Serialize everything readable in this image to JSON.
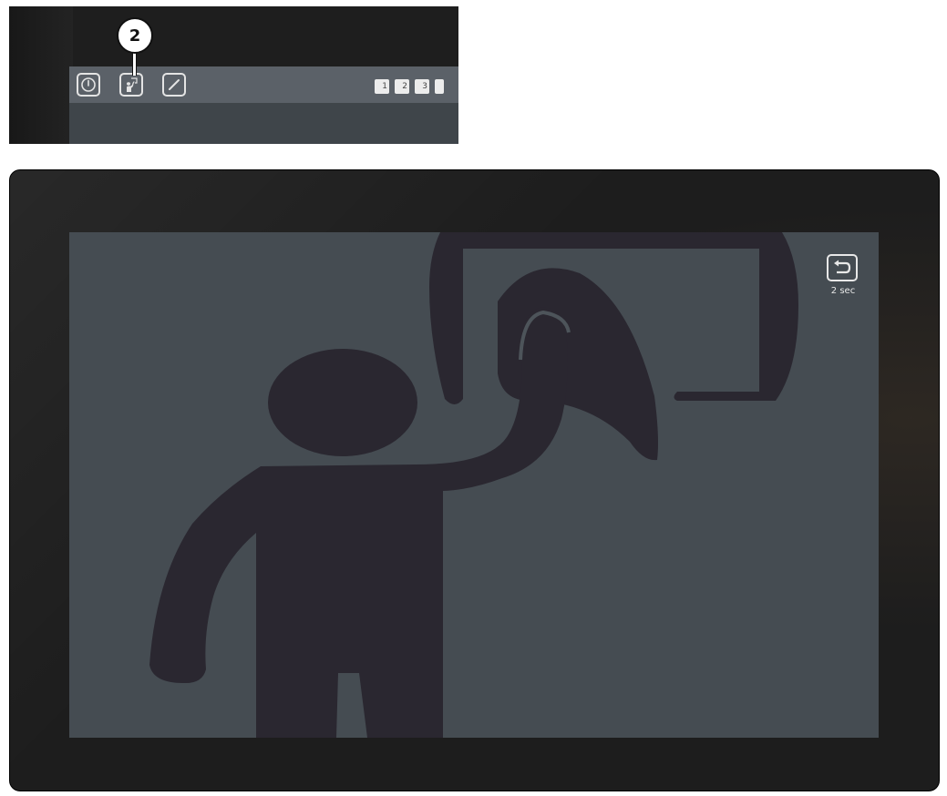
{
  "inset": {
    "callout_number": "2",
    "toolbar": {
      "buttons": [
        {
          "name": "power",
          "icon": "power-icon"
        },
        {
          "name": "screen-clean",
          "icon": "person-wiping-icon"
        },
        {
          "name": "pen",
          "icon": "pen-icon"
        }
      ],
      "pages": [
        "1",
        "2",
        "3",
        ""
      ]
    }
  },
  "screen": {
    "mode_icon": "screen-cleaning-person-icon",
    "exit_icon": "return-arrow-icon",
    "countdown_text": "2 sec"
  },
  "colors": {
    "bezel": "#1d1d1d",
    "screen_bg": "#454c52",
    "toolbar_bg": "#5b6168",
    "silhouette": "#2a2730",
    "icon_stroke": "#e8e8e8"
  }
}
